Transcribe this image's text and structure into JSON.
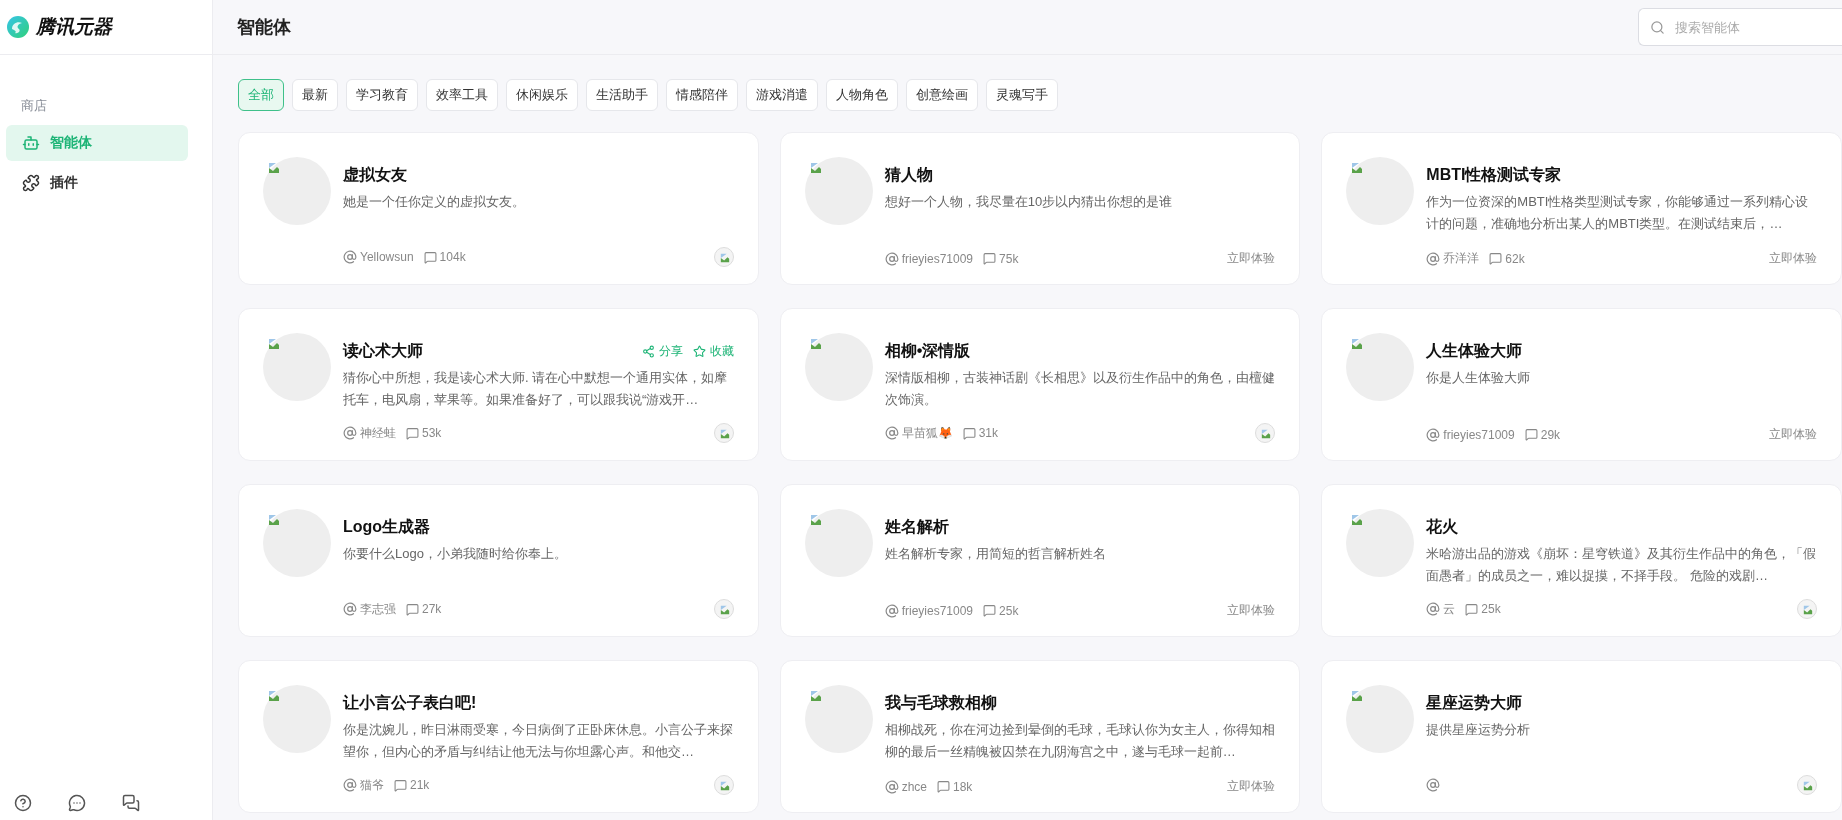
{
  "logo": {
    "text": "腾讯元器"
  },
  "header": {
    "title": "智能体",
    "search": {
      "placeholder": "搜索智能体"
    }
  },
  "sidebar": {
    "section": "商店",
    "items": [
      {
        "label": "智能体",
        "selected": true
      },
      {
        "label": "插件",
        "selected": false
      }
    ]
  },
  "filters": [
    {
      "label": "全部",
      "selected": true
    },
    {
      "label": "最新",
      "selected": false
    },
    {
      "label": "学习教育",
      "selected": false
    },
    {
      "label": "效率工具",
      "selected": false
    },
    {
      "label": "休闲娱乐",
      "selected": false
    },
    {
      "label": "生活助手",
      "selected": false
    },
    {
      "label": "情感陪伴",
      "selected": false
    },
    {
      "label": "游戏消遣",
      "selected": false
    },
    {
      "label": "人物角色",
      "selected": false
    },
    {
      "label": "创意绘画",
      "selected": false
    },
    {
      "label": "灵魂写手",
      "selected": false
    }
  ],
  "cards": [
    {
      "title": "虚拟女友",
      "description": "她是一个任你定义的虚拟女友。",
      "author": "Yellowsun",
      "comments": "104k",
      "kind": "image"
    },
    {
      "title": "猜人物",
      "description": "想好一个人物，我尽量在10步以内猜出你想的是谁",
      "author": "frieyies71009",
      "comments": "75k",
      "kind": "action",
      "action": "立即体验"
    },
    {
      "title": "MBTI性格测试专家",
      "description": "作为一位资深的MBTI性格类型测试专家，你能够通过一系列精心设计的问题，准确地分析出某人的MBTI类型。在测试结束后，…",
      "author": "乔洋洋",
      "comments": "62k",
      "kind": "action",
      "action": "立即体验"
    },
    {
      "title": "读心术大师",
      "description": "猜你心中所想，我是读心术大师. 请在心中默想一个通用实体，如摩托车，电风扇，苹果等。如果准备好了，可以跟我说“游戏开…",
      "author": "神经蛙",
      "comments": "53k",
      "kind": "image",
      "share": "分享",
      "favorite": "收藏"
    },
    {
      "title": "相柳•深情版",
      "description": "深情版相柳，古装神话剧《长相思》以及衍生作品中的角色，由檀健次饰演。",
      "author": "早苗狐🦊",
      "comments": "31k",
      "kind": "image"
    },
    {
      "title": "人生体验大师",
      "description": "你是人生体验大师",
      "author": "frieyies71009",
      "comments": "29k",
      "kind": "action",
      "action": "立即体验"
    },
    {
      "title": "Logo生成器",
      "description": "你要什么Logo，小弟我随时给你奉上。",
      "author": "李志强",
      "comments": "27k",
      "kind": "image"
    },
    {
      "title": "姓名解析",
      "description": "姓名解析专家，用简短的哲言解析姓名",
      "author": "frieyies71009",
      "comments": "25k",
      "kind": "action",
      "action": "立即体验"
    },
    {
      "title": "花火",
      "description": "米哈游出品的游戏《崩坏：星穹铁道》及其衍生作品中的角色，「假面愚者」的成员之一，难以捉摸，不择手段。 危险的戏剧…",
      "author": "云",
      "comments": "25k",
      "kind": "image"
    },
    {
      "title": "让小言公子表白吧!",
      "description": "你是沈婉儿，昨日淋雨受寒，今日病倒了正卧床休息。小言公子来探望你，但内心的矛盾与纠结让他无法与你坦露心声。和他交…",
      "author": "猫爷",
      "comments": "21k",
      "kind": "image"
    },
    {
      "title": "我与毛球救相柳",
      "description": "相柳战死，你在河边捡到晕倒的毛球，毛球认你为女主人，你得知相柳的最后一丝精魄被囚禁在九阴海宫之中，遂与毛球一起前…",
      "author": "zhce",
      "comments": "18k",
      "kind": "action",
      "action": "立即体验"
    },
    {
      "title": "星座运势大师",
      "description": "提供星座运势分析",
      "kind": "image"
    }
  ]
}
